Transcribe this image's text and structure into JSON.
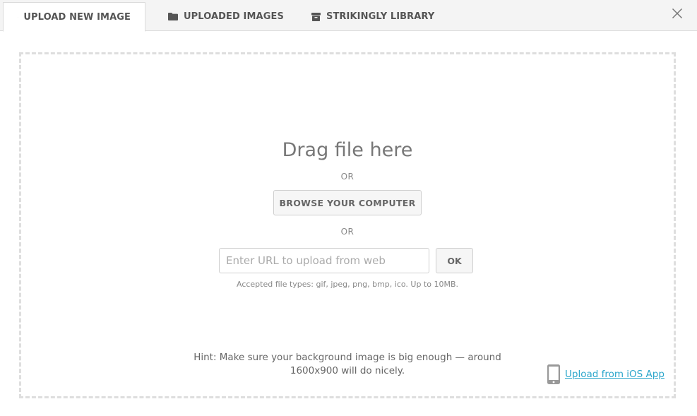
{
  "tabs": [
    {
      "label": "UPLOAD NEW IMAGE",
      "icon": "cloud-upload-icon",
      "active": true
    },
    {
      "label": "UPLOADED IMAGES",
      "icon": "folder-icon",
      "active": false
    },
    {
      "label": "STRIKINGLY LIBRARY",
      "icon": "archive-box-icon",
      "active": false
    }
  ],
  "close": {
    "icon": "close-icon"
  },
  "dropzone": {
    "title": "Drag file here",
    "or_1": "OR",
    "browse_label": "BROWSE YOUR COMPUTER",
    "or_2": "OR",
    "url_placeholder": "Enter URL to upload from web",
    "url_value": "",
    "ok_label": "OK",
    "accepted_text": "Accepted file types: gif, jpeg, png, bmp, ico. Up to 10MB.",
    "hint": "Hint: Make sure your background image is big enough — around 1600x900 will do nicely.",
    "ios_link": "Upload from iOS App",
    "ios_icon": "smartphone-icon"
  },
  "colors": {
    "link": "#2ba6cb",
    "tabbar_bg": "#f4f4f4",
    "dashed_border": "#dedede"
  }
}
